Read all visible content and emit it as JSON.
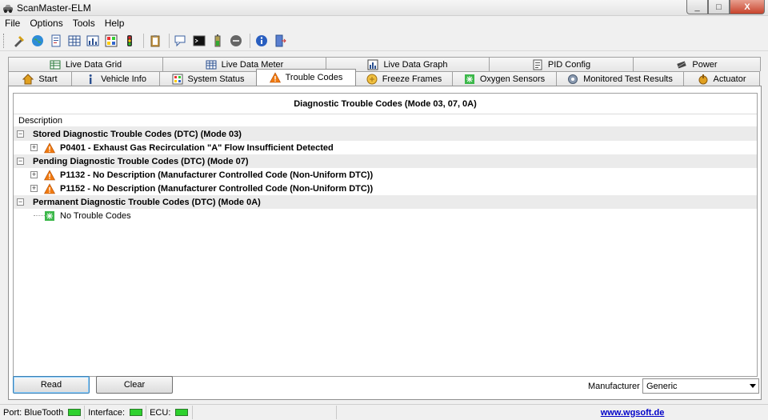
{
  "window": {
    "title": "ScanMaster-ELM",
    "icon": "car-wrench-icon",
    "min": "_",
    "max": "□",
    "close": "X"
  },
  "menu": [
    "File",
    "Options",
    "Tools",
    "Help"
  ],
  "toolbar": {
    "icons": [
      "connect-icon",
      "globe-icon",
      "report-icon",
      "grid-icon",
      "meter-icon",
      "graph-icon",
      "traffic-light-icon",
      "clipboard-icon",
      "chat-icon",
      "terminal-icon",
      "battery-icon",
      "disconnect-icon",
      "info-icon",
      "exit-icon"
    ]
  },
  "tabs_top": [
    {
      "label": "Live Data Grid",
      "icon": "grid-icon"
    },
    {
      "label": "Live Data Meter",
      "icon": "meter-icon"
    },
    {
      "label": "Live Data Graph",
      "icon": "graph-icon"
    },
    {
      "label": "PID Config",
      "icon": "pid-icon"
    },
    {
      "label": "Power",
      "icon": "chip-icon"
    }
  ],
  "tabs_bottom": [
    {
      "label": "Start",
      "icon": "home-icon"
    },
    {
      "label": "Vehicle Info",
      "icon": "info-icon"
    },
    {
      "label": "System Status",
      "icon": "status-icon"
    },
    {
      "label": "Trouble Codes",
      "icon": "warning-icon",
      "active": true
    },
    {
      "label": "Freeze Frames",
      "icon": "freeze-icon"
    },
    {
      "label": "Oxygen Sensors",
      "icon": "sensor-icon"
    },
    {
      "label": "Monitored Test Results",
      "icon": "gear-icon"
    },
    {
      "label": "Actuator",
      "icon": "actuator-icon"
    }
  ],
  "panel": {
    "header": "Diagnostic Trouble Codes (Mode 03, 07, 0A)",
    "column": "Description",
    "groups": [
      {
        "label": "Stored Diagnostic Trouble Codes (DTC) (Mode 03)",
        "items": [
          "P0401 - Exhaust Gas Recirculation \"A\" Flow Insufficient Detected"
        ]
      },
      {
        "label": "Pending Diagnostic Trouble Codes (DTC) (Mode 07)",
        "items": [
          "P1132 - No Description (Manufacturer Controlled Code (Non-Uniform DTC))",
          "P1152 - No Description (Manufacturer Controlled Code (Non-Uniform DTC))"
        ]
      },
      {
        "label": "Permanent Diagnostic Trouble Codes (DTC) (Mode 0A)",
        "empty": "No Trouble Codes"
      }
    ],
    "read_label": "Read",
    "clear_label": "Clear",
    "manufacturer_label": "Manufacturer",
    "manufacturer_value": "Generic"
  },
  "status": {
    "port_label": "Port:",
    "port_value": "BlueTooth",
    "interface_label": "Interface:",
    "ecu_label": "ECU:",
    "link": "www.wgsoft.de",
    "led_color": "#2ed12e"
  },
  "colors": {
    "warning": "#f07a10",
    "ok": "#3cb84a",
    "group_bg": "#ebebeb"
  }
}
